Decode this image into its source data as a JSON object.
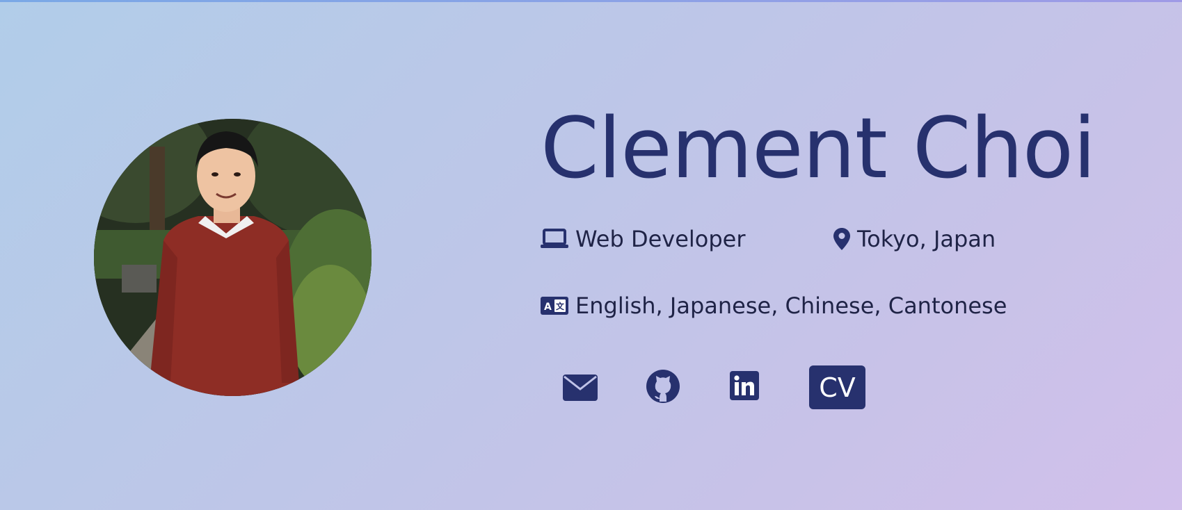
{
  "profile": {
    "name": "Clement Choi",
    "job_title": "Web Developer",
    "location": "Tokyo, Japan",
    "languages": "English, Japanese, Chinese, Cantonese"
  },
  "links": {
    "cv_label": "CV"
  },
  "icons": {
    "job": "laptop-icon",
    "location": "map-pin-icon",
    "languages": "language-icon",
    "email": "envelope-icon",
    "github": "github-icon",
    "linkedin": "linkedin-icon"
  },
  "colors": {
    "accent": "#27316e",
    "text": "#1f2346",
    "background_start": "#b1cde9",
    "background_end": "#d1c0eb"
  }
}
